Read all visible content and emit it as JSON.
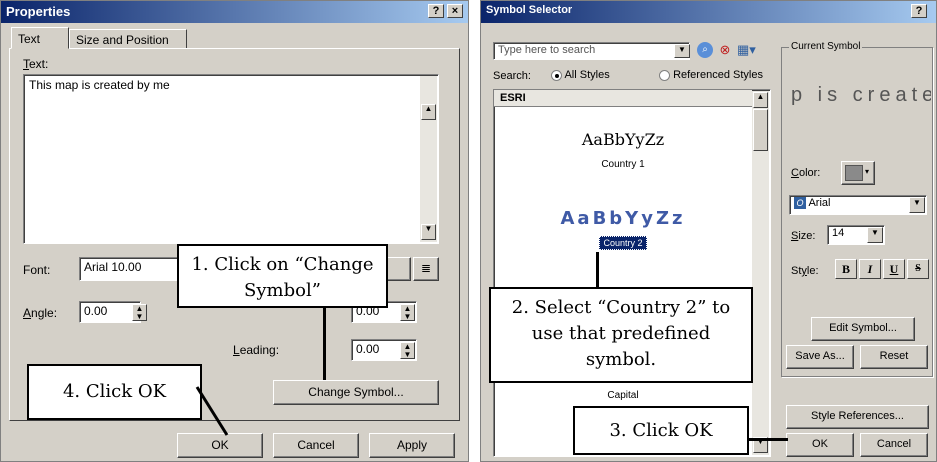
{
  "properties": {
    "title": "Properties",
    "help_label": "?",
    "close_label": "×",
    "tabs": [
      "Text",
      "Size and Position"
    ],
    "text_label": "Text:",
    "text_value": "This map is created by me",
    "font_label": "Font:",
    "font_value": "Arial 10.00",
    "angle_label": "Angle:",
    "angle_value": "0.00",
    "leading_label": "Leading:",
    "leading_value": "0.00",
    "char_spacing_value": "0.00",
    "change_symbol_label": "Change Symbol...",
    "ok_label": "OK",
    "cancel_label": "Cancel",
    "apply_label": "Apply"
  },
  "symbol_selector": {
    "title": "Symbol Selector",
    "help_label": "?",
    "search_placeholder": "Type here to search",
    "search_label": "Search:",
    "radio_all_styles": "All Styles",
    "radio_referenced_styles": "Referenced Styles",
    "list_header": "ESRI",
    "items": [
      {
        "sample": "AaBbYyZz",
        "name": "Country 1"
      },
      {
        "sample": "AaBbYyZz",
        "name": "Country 2"
      },
      {
        "sample": "",
        "name": "Capital"
      }
    ],
    "current_symbol_label": "Current Symbol",
    "current_symbol_preview": "p is createc",
    "color_label": "Color:",
    "color_value": "#8a8a8a",
    "font_value": "Arial",
    "size_label": "Size:",
    "size_value": "14",
    "style_label": "Style:",
    "style_buttons": [
      "B",
      "I",
      "U",
      "S"
    ],
    "edit_symbol_label": "Edit Symbol...",
    "save_as_label": "Save As...",
    "reset_label": "Reset",
    "style_references_label": "Style References...",
    "ok_label": "OK",
    "cancel_label": "Cancel"
  },
  "callouts": {
    "step1": "1. Click on “Change Symbol”",
    "step2": "2. Select “Country 2” to use that predefined symbol.",
    "step3": "3. Click OK",
    "step4": "4. Click OK"
  }
}
